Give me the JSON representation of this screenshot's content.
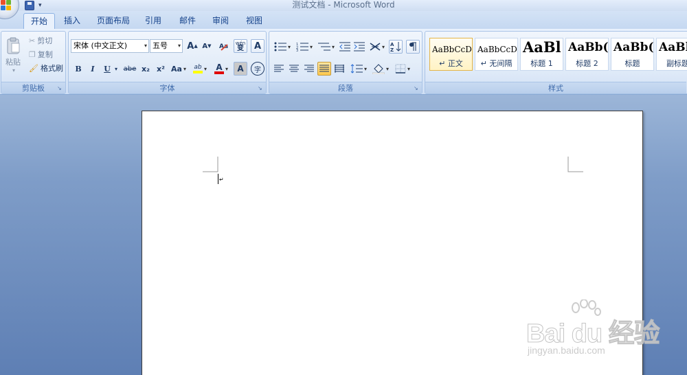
{
  "window": {
    "title": "测试文档 - Microsoft Word"
  },
  "quick_access": {
    "icons": [
      "save-icon",
      "customize-dropdown-icon"
    ]
  },
  "tabs": [
    {
      "label": "开始",
      "active": true
    },
    {
      "label": "插入"
    },
    {
      "label": "页面布局"
    },
    {
      "label": "引用"
    },
    {
      "label": "邮件"
    },
    {
      "label": "审阅"
    },
    {
      "label": "视图"
    }
  ],
  "clipboard": {
    "paste": "粘贴",
    "cut": "剪切",
    "copy": "复制",
    "format_painter": "格式刷",
    "label": "剪贴板"
  },
  "font": {
    "name": "宋体 (中文正文)",
    "size": "五号",
    "grow": "A",
    "shrink": "A",
    "bold": "B",
    "italic": "I",
    "underline": "U",
    "strike": "abe",
    "subscript": "x₂",
    "superscript": "x²",
    "change_case": "Aa",
    "highlight": "ab",
    "font_color": "A",
    "char_shade": "A",
    "enclose": "字",
    "phonetic": "wén",
    "phonetic_char": "变",
    "border_char": "A",
    "label": "字体",
    "accent_colors": {
      "highlight": "#ffff00",
      "font_color": "#e00000"
    }
  },
  "paragraph": {
    "label": "段落"
  },
  "styles": {
    "label": "样式",
    "items": [
      {
        "sample": "AaBbCcDc",
        "name": "↵ 正文",
        "selected": true
      },
      {
        "sample": "AaBbCcDc",
        "name": "↵ 无间隔"
      },
      {
        "sample": "AaBl",
        "name": "标题 1"
      },
      {
        "sample": "AaBb(",
        "name": "标题 2"
      },
      {
        "sample": "AaBb(",
        "name": "标题"
      },
      {
        "sample": "AaBl",
        "name": "副标题"
      }
    ]
  },
  "watermark": {
    "brand": "Bai du 经验",
    "url": "jingyan.baidu.com"
  }
}
